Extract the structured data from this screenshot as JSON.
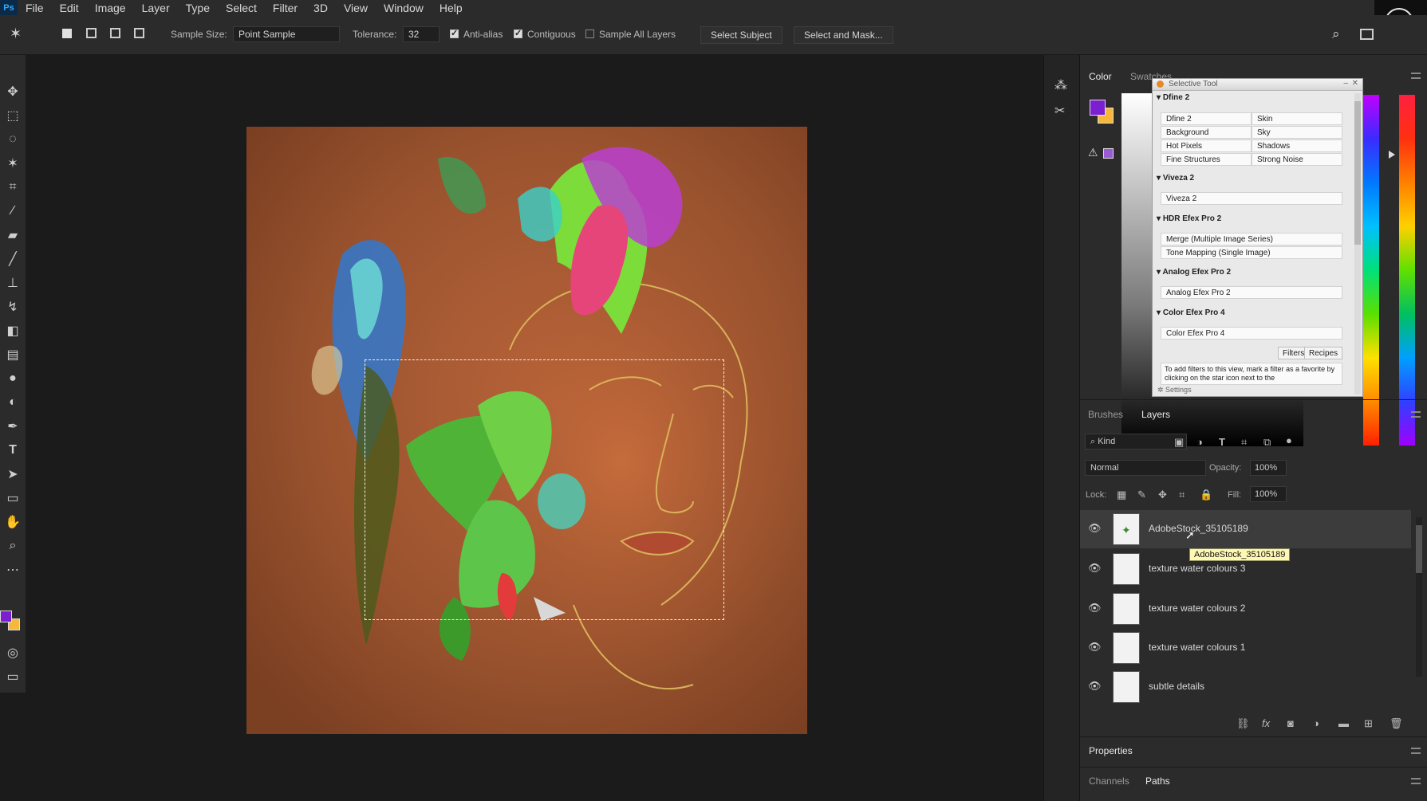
{
  "app": {
    "logo": "Ps"
  },
  "menu": [
    "File",
    "Edit",
    "Image",
    "Layer",
    "Type",
    "Select",
    "Filter",
    "3D",
    "View",
    "Window",
    "Help"
  ],
  "options": {
    "sample_size_label": "Sample Size:",
    "sample_size_value": "Point Sample",
    "tolerance_label": "Tolerance:",
    "tolerance_value": "32",
    "anti_alias": "Anti-alias",
    "contiguous": "Contiguous",
    "sample_all_layers": "Sample All Layers",
    "select_subject": "Select Subject",
    "select_and_mask": "Select and Mask..."
  },
  "color_panel": {
    "tabs": [
      "Color",
      "Swatches"
    ],
    "foreground": "#7b1fd0",
    "background": "#f5b83a"
  },
  "selective_tool": {
    "title": "Selective Tool",
    "sections": [
      {
        "heading": "Dfine 2",
        "cells": [
          [
            "Dfine 2",
            "Skin"
          ],
          [
            "Background",
            "Sky"
          ],
          [
            "Hot Pixels",
            "Shadows"
          ],
          [
            "Fine Structures",
            "Strong Noise"
          ]
        ]
      },
      {
        "heading": "Viveza 2",
        "rows": [
          "Viveza 2"
        ]
      },
      {
        "heading": "HDR Efex Pro 2",
        "rows": [
          "Merge (Multiple Image Series)",
          "Tone Mapping (Single Image)"
        ]
      },
      {
        "heading": "Analog Efex Pro 2",
        "rows": [
          "Analog Efex Pro 2"
        ]
      },
      {
        "heading": "Color Efex Pro 4",
        "rows": [
          "Color Efex Pro 4"
        ]
      }
    ],
    "buttons": [
      "Filters",
      "Recipes"
    ],
    "hint": "To add filters to this view, mark a filter as a favorite by clicking on the star icon next to the",
    "settings": "Settings"
  },
  "layers_panel": {
    "tabs": [
      "Brushes",
      "Layers"
    ],
    "filter_kind": "Kind",
    "blend_mode": "Normal",
    "opacity_label": "Opacity:",
    "opacity_value": "100%",
    "lock_label": "Lock:",
    "fill_label": "Fill:",
    "fill_value": "100%",
    "layers": [
      {
        "name": "AdobeStock_35105189",
        "selected": true
      },
      {
        "name": "texture water colours 3",
        "selected": false
      },
      {
        "name": "texture water colours 2",
        "selected": false
      },
      {
        "name": "texture water colours 1",
        "selected": false
      },
      {
        "name": "subtle details",
        "selected": false
      }
    ],
    "tooltip": "AdobeStock_35105189"
  },
  "bottom_panels": {
    "properties": "Properties",
    "channels": "Channels",
    "paths": "Paths"
  }
}
